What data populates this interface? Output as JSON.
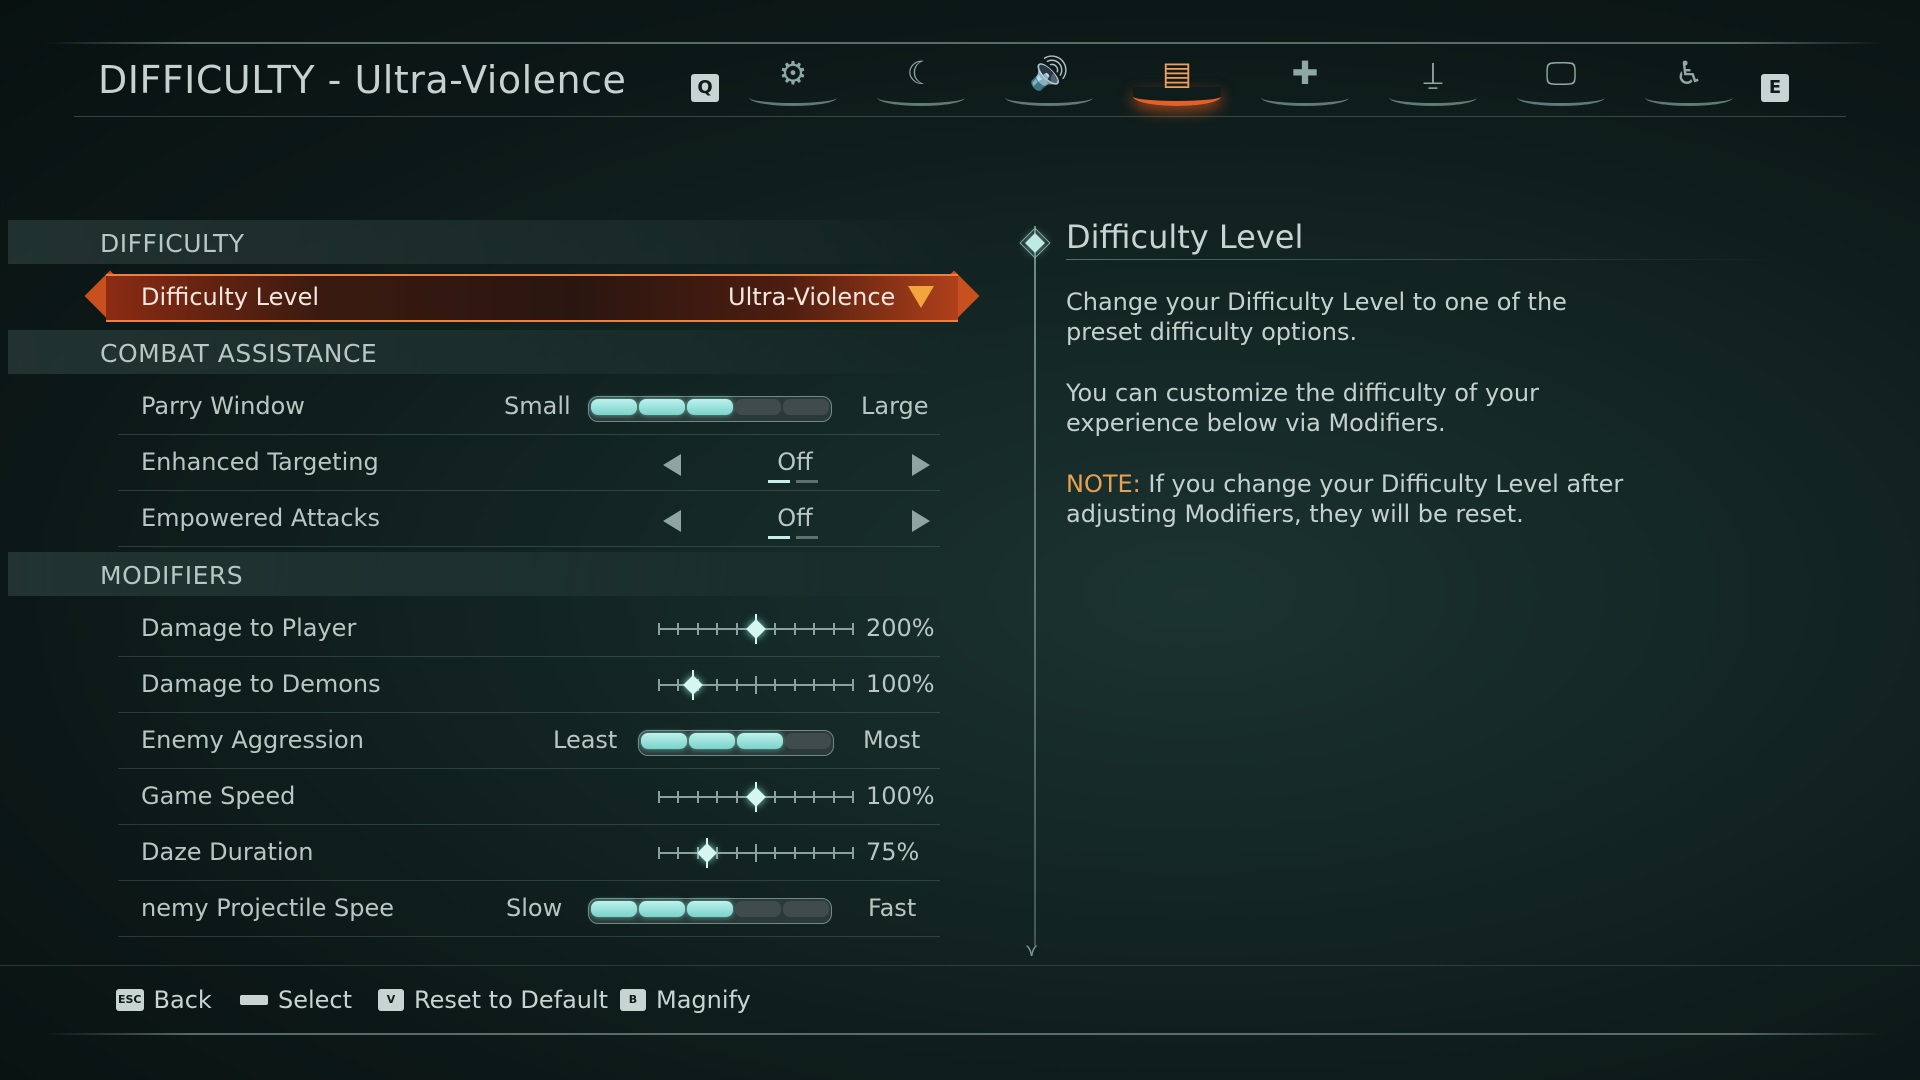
{
  "header": {
    "title": "DIFFICULTY - Ultra-Violence",
    "key_prev": "Q",
    "key_next": "E",
    "tabs": [
      {
        "icon": "gear-icon",
        "glyph": "⚙",
        "active": false
      },
      {
        "icon": "controller-icon",
        "glyph": "☾",
        "active": false
      },
      {
        "icon": "speaker-icon",
        "glyph": "🔊",
        "active": false
      },
      {
        "icon": "difficulty-icon",
        "glyph": "▤",
        "active": true
      },
      {
        "icon": "crosshair-icon",
        "glyph": "✚",
        "active": false
      },
      {
        "icon": "joystick-icon",
        "glyph": "⍊",
        "active": false
      },
      {
        "icon": "monitor-icon",
        "glyph": "🖵",
        "active": false
      },
      {
        "icon": "accessibility-icon",
        "glyph": "♿",
        "active": false
      }
    ]
  },
  "sections": {
    "difficulty": "DIFFICULTY",
    "combat_assistance": "COMBAT ASSISTANCE",
    "modifiers": "MODIFIERS"
  },
  "settings": {
    "difficulty_level": {
      "label": "Difficulty Level",
      "value": "Ultra-Violence"
    },
    "parry_window": {
      "label": "Parry Window",
      "min_label": "Small",
      "max_label": "Large",
      "level": 3,
      "steps": 5
    },
    "enhanced_targeting": {
      "label": "Enhanced Targeting",
      "value": "Off"
    },
    "empowered_attacks": {
      "label": "Empowered Attacks",
      "value": "Off"
    },
    "damage_to_player": {
      "label": "Damage to Player",
      "value": "200%",
      "position": 0.5
    },
    "damage_to_demons": {
      "label": "Damage to Demons",
      "value": "100%",
      "position": 0.18
    },
    "enemy_aggression": {
      "label": "Enemy Aggression",
      "min_label": "Least",
      "max_label": "Most",
      "level": 3,
      "steps": 4
    },
    "game_speed": {
      "label": "Game Speed",
      "value": "100%",
      "position": 0.5
    },
    "daze_duration": {
      "label": "Daze Duration",
      "value": "75%",
      "position": 0.25
    },
    "enemy_projectile_speed": {
      "label": "nemy Projectile Spee",
      "min_label": "Slow",
      "max_label": "Fast",
      "level": 3,
      "steps": 5
    }
  },
  "description": {
    "title": "Difficulty Level",
    "p1": "Change your Difficulty Level to one of the preset difficulty options.",
    "p2": "You can customize the difficulty of your experience below via Modifiers.",
    "note_label": "NOTE:",
    "note_text": " If you change your Difficulty Level after adjusting Modifiers, they will be reset."
  },
  "footer": {
    "back": {
      "key": "ESC",
      "label": "Back"
    },
    "select": {
      "key": "",
      "label": "Select"
    },
    "reset": {
      "key": "V",
      "label": "Reset to Default"
    },
    "magnify": {
      "key": "B",
      "label": "Magnify"
    }
  },
  "colors": {
    "accent": "#e4602a",
    "highlight": "#f2a43d",
    "slider_on": "#9fe3dc"
  }
}
